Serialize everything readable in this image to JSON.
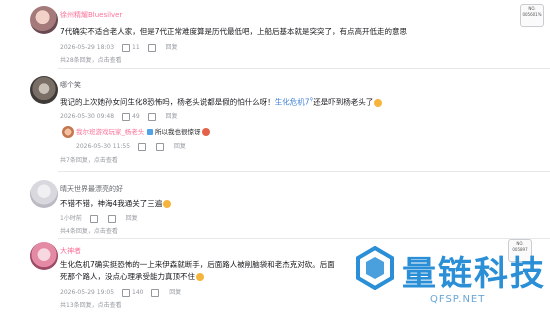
{
  "comments": [
    {
      "username": "徐州精耀Bluesilver",
      "text": "7代确实不适合老人家，但是7代正常难度算是历代最低吧，上船后基本就是突突了，有点高开低走的意思",
      "date": "2026-05-29 18:03",
      "likes": "11",
      "reply_label": "回复",
      "replies_summary": "共28条回复，点击查看",
      "badge": "NO.\n005601%"
    },
    {
      "username": "哪个笑",
      "text_part1": "我记的上次她孙女问生化8恐怖吗，杨老头说都是假的怕什么呀！",
      "mention": "生化危机7",
      "text_part2": "还是吓到杨老头了",
      "date": "2026-05-30 09:48",
      "likes": "49",
      "reply_label": "回复",
      "sub_reply": {
        "username": "我尔班游戏玩家_杨老头",
        "text": "所以我也很惊讶",
        "date": "2026-05-30 11:55",
        "likes": "",
        "reply_label": "回复"
      },
      "replies_summary": "共7条回复，点击查看"
    },
    {
      "username": "晴天世界最漂亮的好",
      "text": "不错不错，神海4我通关了三遍",
      "date": "1小时前",
      "likes": "",
      "reply_label": "回复",
      "replies_summary": "共4条回复，点击查看"
    },
    {
      "username": "大神者",
      "text_line1": "生化危机7确实挺恐怖的一上来伊森就断手，后面路人被削脑袋和老杰克对砍。后面",
      "text_line2": "死那个路人，没点心理承受能力真顶不住",
      "date": "2026-05-29 19:05",
      "likes": "140",
      "reply_label": "回复",
      "replies_summary": "共13条回复，点击查看",
      "badge": "NO.\n005897"
    }
  ],
  "watermark": {
    "text": "量链科技",
    "domain": "QFSP.NET"
  },
  "colors": {
    "mention": "#3f7fd4",
    "meta": "#9499a0",
    "watermark": "#2a8fd6"
  }
}
